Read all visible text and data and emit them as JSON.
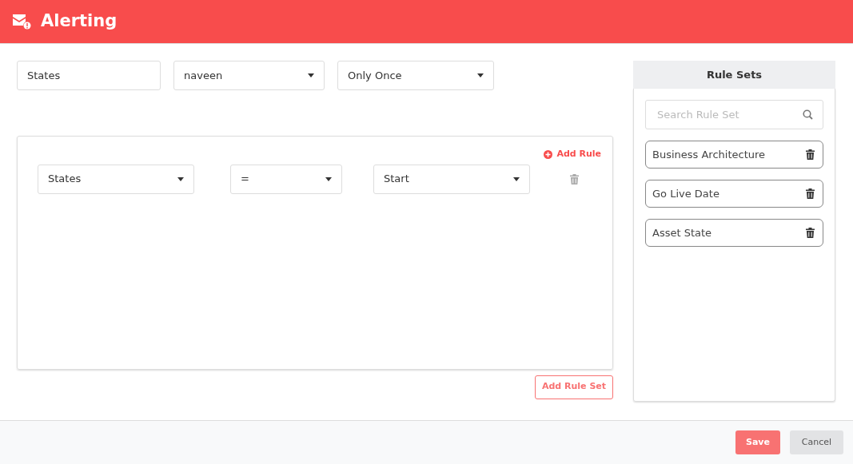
{
  "header": {
    "title": "Alerting"
  },
  "filters": [
    {
      "kind": "text",
      "value": "States"
    },
    {
      "kind": "select",
      "value": "naveen"
    },
    {
      "kind": "select",
      "value": "Only Once"
    }
  ],
  "rule_panel": {
    "add_rule": "Add Rule",
    "rules": [
      {
        "field": "States",
        "operator": "=",
        "value": "Start"
      }
    ]
  },
  "add_rule_set": "Add Rule Set",
  "rule_sets": {
    "title": "Rule Sets",
    "search": {
      "placeholder": "Search Rule Set"
    },
    "items": [
      {
        "label": "Business Architecture"
      },
      {
        "label": "Go Live Date"
      },
      {
        "label": "Asset State"
      }
    ]
  },
  "footer": {
    "buttons": [
      {
        "label": "Save",
        "kind": "primary"
      },
      {
        "label": "Cancel",
        "kind": "secondary"
      }
    ]
  }
}
